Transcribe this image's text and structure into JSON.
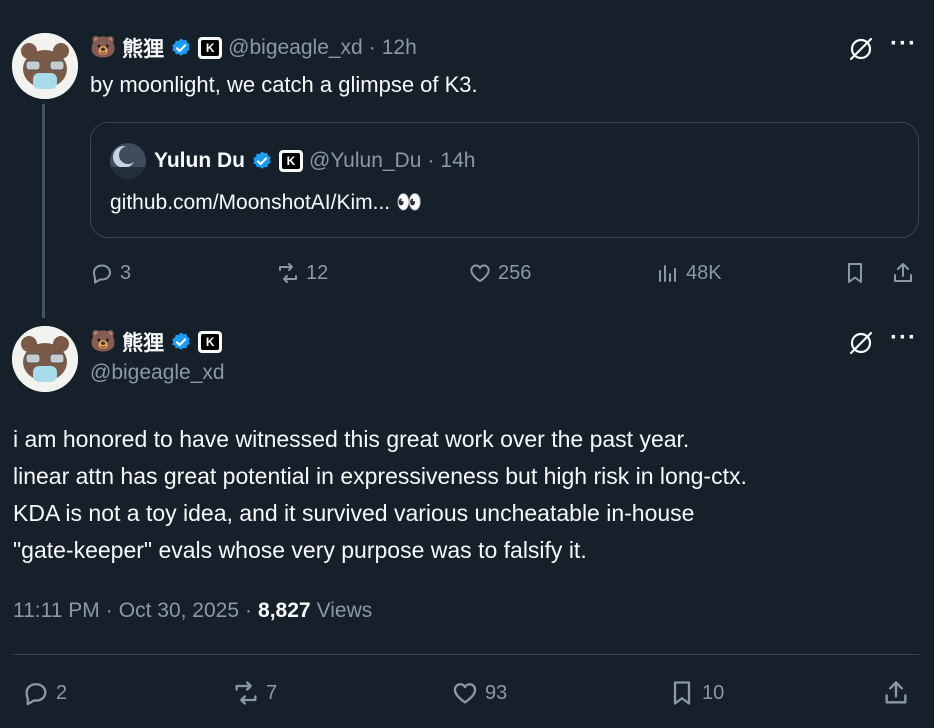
{
  "tweet1": {
    "emoji": "🐻",
    "display_name": "熊狸",
    "handle": "@bigeagle_xd",
    "separator": "·",
    "time": "12h",
    "text": "by moonlight, we catch a glimpse of K3.",
    "quoted": {
      "display_name": "Yulun Du",
      "handle": "@Yulun_Du",
      "separator": "·",
      "time": "14h",
      "text": "github.com/MoonshotAI/Kim... 👀"
    },
    "actions": {
      "replies": "3",
      "reposts": "12",
      "likes": "256",
      "views": "48K"
    }
  },
  "tweet2": {
    "emoji": "🐻",
    "display_name": "熊狸",
    "handle": "@bigeagle_xd",
    "text_lines": [
      "i am honored to have witnessed this great work over the past year.",
      "linear attn has great potential in expressiveness but high risk in long-ctx.",
      "KDA is not a toy idea, and it survived various uncheatable in-house",
      "\"gate-keeper\" evals whose very purpose was to falsify it."
    ],
    "meta": {
      "time": "11:11 PM",
      "dot1": "·",
      "date": "Oct 30, 2025",
      "dot2": "·",
      "views_count": "8,827",
      "views_label": "Views"
    },
    "actions": {
      "replies": "2",
      "reposts": "7",
      "likes": "93",
      "bookmarks": "10"
    }
  },
  "badge_letter": "K",
  "more_label": "···",
  "colors": {
    "background": "#15202b",
    "verified": "#1d9bf0",
    "muted": "#8b98a5"
  }
}
